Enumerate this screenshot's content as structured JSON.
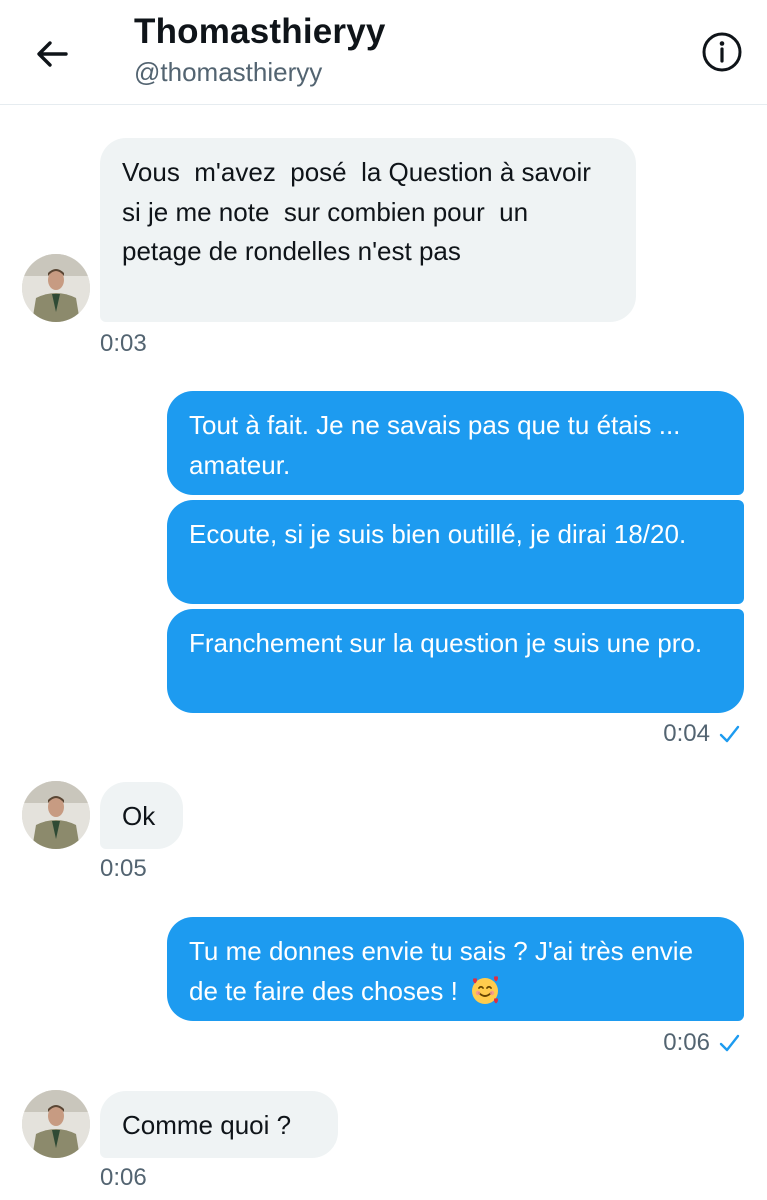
{
  "header": {
    "name": "Thomasthieryy",
    "handle": "@thomasthieryy"
  },
  "messages": [
    {
      "direction": "in",
      "text": "Vous  m'avez  posé  la Question à savoir  si je me note  sur combien pour  un petage de rondelles n'est pas",
      "time": "0:03"
    },
    {
      "direction": "out",
      "text": "Tout à fait. Je ne savais pas que tu étais ... amateur."
    },
    {
      "direction": "out",
      "text": "Ecoute, si je suis bien outillé, je dirai 18/20."
    },
    {
      "direction": "out",
      "text": "Franchement sur la question je suis une pro.",
      "time": "0:04",
      "status": "sent-check"
    },
    {
      "direction": "in",
      "text": "Ok",
      "time": "0:05"
    },
    {
      "direction": "out",
      "text": "Tu me donnes envie tu sais ? J'ai très envie de te faire des choses !",
      "emoji": "smiling-face-with-hearts-emoji",
      "time": "0:06",
      "status": "sent-check"
    },
    {
      "direction": "in",
      "text": "Comme quoi ?",
      "time": "0:06"
    }
  ],
  "colors": {
    "accent": "#1d9bf0",
    "incoming_bubble": "#eff3f4",
    "timestamp": "#536471"
  }
}
